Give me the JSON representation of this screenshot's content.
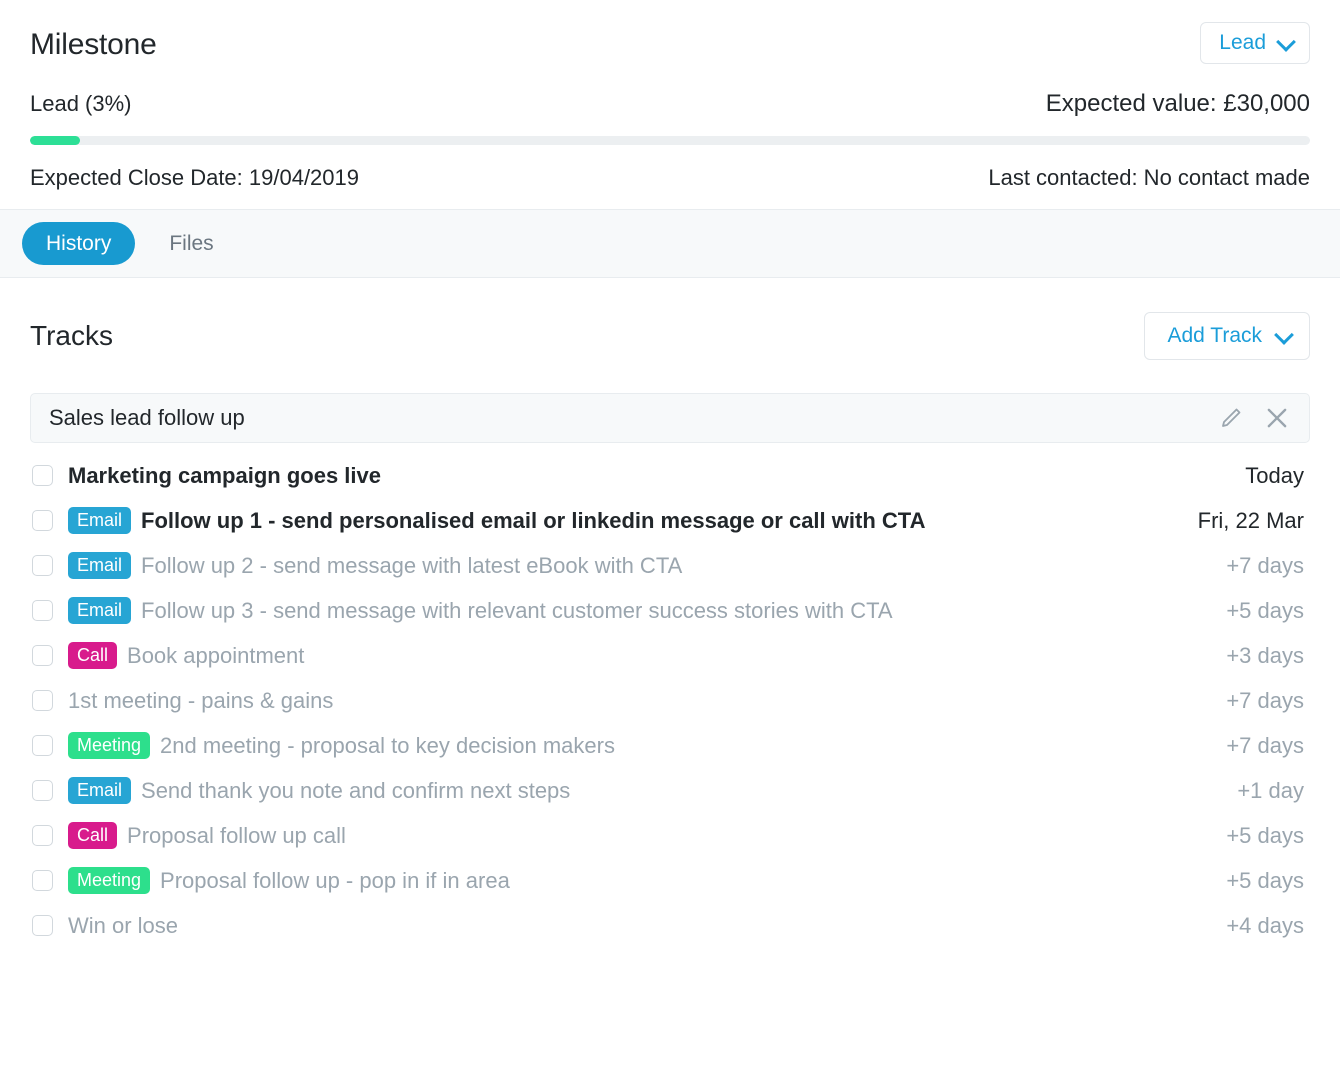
{
  "header": {
    "title": "Milestone",
    "stage_dropdown": {
      "label": "Lead",
      "icon": "chevron-down-icon"
    },
    "stage_label": "Lead (3%)",
    "expected_value": "Expected value: £30,000",
    "progress_percent": 3,
    "progress_color": "#2ddf96",
    "expected_close_date": "Expected Close Date: 19/04/2019",
    "last_contacted": "Last contacted: No contact made"
  },
  "tabs": [
    {
      "label": "History",
      "active": true
    },
    {
      "label": "Files",
      "active": false
    }
  ],
  "tracks_section": {
    "title": "Tracks",
    "add_track": {
      "label": "Add Track",
      "icon": "chevron-down-icon"
    }
  },
  "track": {
    "name": "Sales lead follow up",
    "edit_icon": "pencil-icon",
    "delete_icon": "close-icon",
    "tasks": [
      {
        "badge": null,
        "badge_type": null,
        "text": "Marketing campaign goes live",
        "date": "Today",
        "emphasis": "bold"
      },
      {
        "badge": "Email",
        "badge_type": "email",
        "text": "Follow up 1 - send personalised email or linkedin message or call with CTA",
        "date": "Fri, 22 Mar",
        "emphasis": "bold"
      },
      {
        "badge": "Email",
        "badge_type": "email",
        "text": "Follow up 2 - send message with latest eBook with CTA",
        "date": "+7 days",
        "emphasis": "muted"
      },
      {
        "badge": "Email",
        "badge_type": "email",
        "text": "Follow up 3 - send message with relevant customer success stories with CTA",
        "date": "+5 days",
        "emphasis": "muted"
      },
      {
        "badge": "Call",
        "badge_type": "call",
        "text": "Book appointment",
        "date": "+3 days",
        "emphasis": "muted"
      },
      {
        "badge": null,
        "badge_type": null,
        "text": "1st meeting - pains & gains",
        "date": "+7 days",
        "emphasis": "muted"
      },
      {
        "badge": "Meeting",
        "badge_type": "meeting",
        "text": "2nd meeting - proposal to key decision makers",
        "date": "+7 days",
        "emphasis": "muted"
      },
      {
        "badge": "Email",
        "badge_type": "email",
        "text": "Send thank you note and confirm next steps",
        "date": "+1 day",
        "emphasis": "muted"
      },
      {
        "badge": "Call",
        "badge_type": "call",
        "text": "Proposal follow up call",
        "date": "+5 days",
        "emphasis": "muted"
      },
      {
        "badge": "Meeting",
        "badge_type": "meeting",
        "text": "Proposal follow up - pop in if in area",
        "date": "+5 days",
        "emphasis": "muted"
      },
      {
        "badge": null,
        "badge_type": null,
        "text": "Win or lose",
        "date": "+4 days",
        "emphasis": "muted"
      }
    ]
  },
  "colors": {
    "accent_blue": "#189ad0",
    "link_blue": "#1b9dd9",
    "badge_email": "#27a5d4",
    "badge_call": "#d81b8c",
    "badge_meeting": "#2ddf8c",
    "progress_green": "#2ddf96",
    "text_dark": "#22272b",
    "text_muted": "#9aa5ae"
  }
}
